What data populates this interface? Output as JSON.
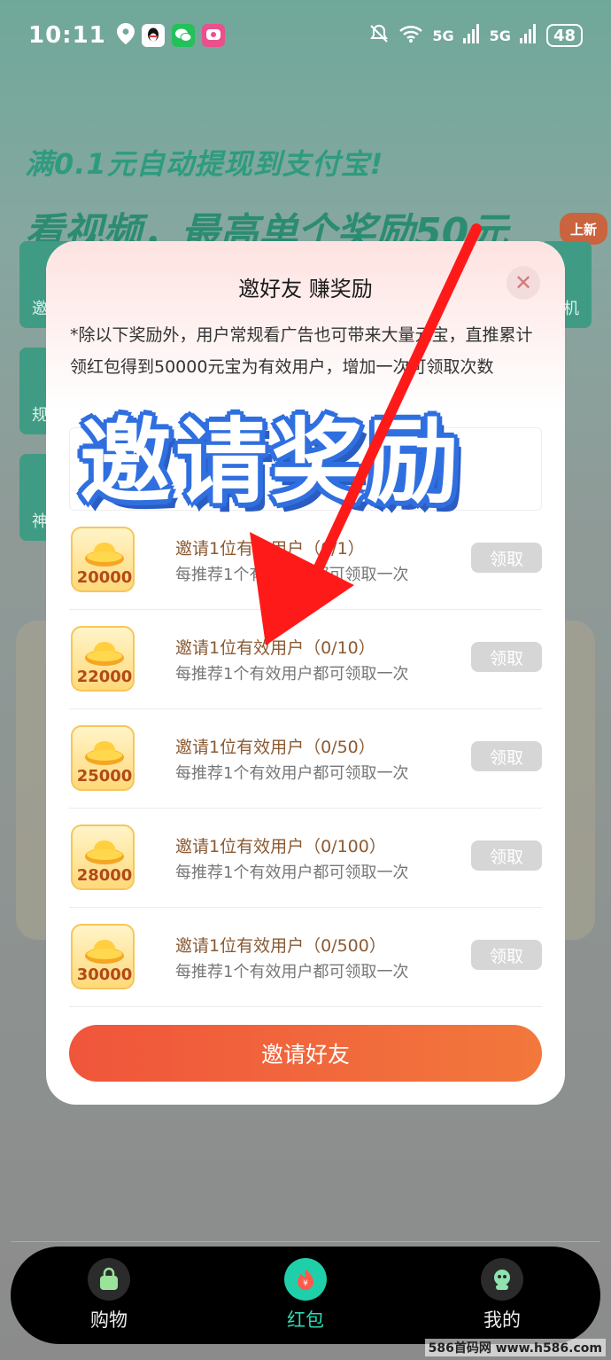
{
  "status_bar": {
    "time": "10:11",
    "battery": "48",
    "network_1": "5G",
    "network_2": "5G"
  },
  "background": {
    "banner_1": "满0.1元自动提现到支付宝!",
    "banner_2": "看视频，最高单个奖励50元",
    "new_badge": "上新",
    "side_tiles": [
      "邀",
      "规",
      "神"
    ],
    "right_tile": "机"
  },
  "modal": {
    "title": "邀好友 赚奖励",
    "close_icon": "close-icon",
    "description": "*除以下奖励外，用户常规看广告也可带来大量元宝，直推累计领红包得到50000元宝为有效用户，增加一次可领取次数",
    "rewards": [
      {
        "amount": "20000",
        "title": "邀请1位有效用户（0/1）",
        "subtitle": "每推荐1个有效用户都可领取一次",
        "button": "领取"
      },
      {
        "amount": "22000",
        "title": "邀请1位有效用户（0/10）",
        "subtitle": "每推荐1个有效用户都可领取一次",
        "button": "领取"
      },
      {
        "amount": "25000",
        "title": "邀请1位有效用户（0/50）",
        "subtitle": "每推荐1个有效用户都可领取一次",
        "button": "领取"
      },
      {
        "amount": "28000",
        "title": "邀请1位有效用户（0/100）",
        "subtitle": "每推荐1个有效用户都可领取一次",
        "button": "领取"
      },
      {
        "amount": "30000",
        "title": "邀请1位有效用户（0/500）",
        "subtitle": "每推荐1个有效用户都可领取一次",
        "button": "领取"
      }
    ],
    "invite_button": "邀请好友"
  },
  "overlay": {
    "promo_text": "邀请奖励"
  },
  "bottom_nav": {
    "items": [
      {
        "label": "购物",
        "icon": "shopping-bag-icon",
        "active": false
      },
      {
        "label": "红包",
        "icon": "red-envelope-icon",
        "active": true
      },
      {
        "label": "我的",
        "icon": "profile-icon",
        "active": false
      }
    ]
  },
  "watermark": "586首码网 www.h586.com",
  "colors": {
    "accent": "#f0553b",
    "active_nav": "#2bd9b4",
    "promo_outline": "#2f6fe0",
    "arrow": "#ff1a1a"
  }
}
